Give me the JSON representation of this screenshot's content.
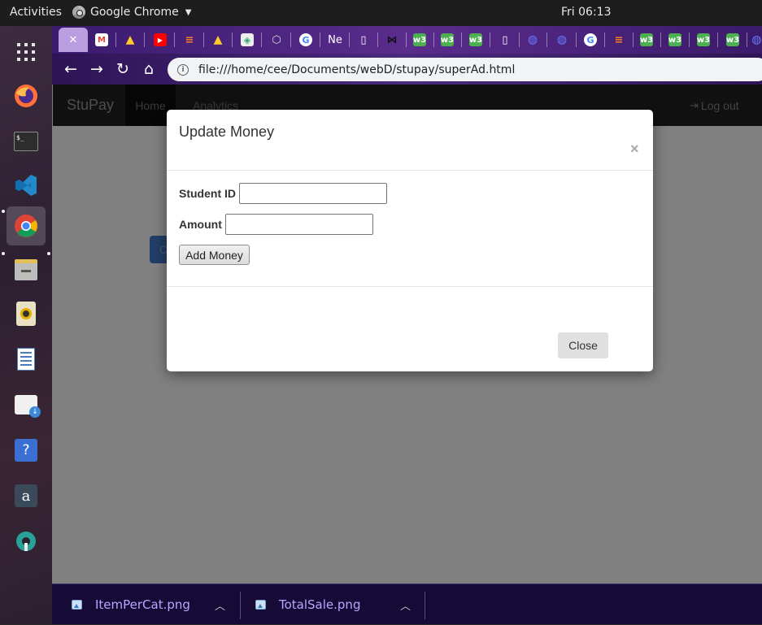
{
  "topbar": {
    "activities": "Activities",
    "app_name": "Google Chrome",
    "clock": "Fri 06:13"
  },
  "dock": {
    "apps": [
      "app-grid-icon",
      "firefox-icon",
      "terminal-icon",
      "vscode-icon",
      "chrome-icon",
      "files-icon",
      "rhythmbox-icon",
      "writer-icon",
      "software-icon",
      "help-icon",
      "amazon-icon",
      "settings-icon"
    ]
  },
  "browser": {
    "tabs": [
      {
        "icon": "close-icon",
        "label": "✕"
      },
      {
        "icon": "gmail-icon",
        "label": "M"
      },
      {
        "icon": "firebase-icon",
        "label": ""
      },
      {
        "icon": "youtube-icon",
        "label": "▶"
      },
      {
        "icon": "stackoverflow-icon",
        "label": ""
      },
      {
        "icon": "firebase-icon",
        "label": ""
      },
      {
        "icon": "diamond-icon",
        "label": ""
      },
      {
        "icon": "codepen-icon",
        "label": ""
      },
      {
        "icon": "google-icon",
        "label": "G"
      },
      {
        "icon": "new-tab-text",
        "label": "Ne"
      },
      {
        "icon": "document-icon",
        "label": ""
      },
      {
        "icon": "bowtie-icon",
        "label": "⋈"
      },
      {
        "icon": "w3schools-icon",
        "label": "w3"
      },
      {
        "icon": "w3schools-icon",
        "label": "w3"
      },
      {
        "icon": "w3schools-icon",
        "label": "w3"
      },
      {
        "icon": "document-icon",
        "label": ""
      },
      {
        "icon": "globe-icon",
        "label": ""
      },
      {
        "icon": "globe-icon",
        "label": ""
      },
      {
        "icon": "google-icon",
        "label": "G"
      },
      {
        "icon": "stackoverflow-icon",
        "label": ""
      },
      {
        "icon": "w3schools-icon",
        "label": "w3"
      },
      {
        "icon": "w3schools-icon",
        "label": "w3"
      },
      {
        "icon": "w3schools-icon",
        "label": "w3"
      },
      {
        "icon": "w3schools-icon",
        "label": "w3"
      },
      {
        "icon": "globe-icon",
        "label": ""
      }
    ],
    "url": "file:///home/cee/Documents/webD/stupay/superAd.html"
  },
  "page": {
    "brand": "StuPay",
    "nav_home": "Home",
    "nav_analytics": "Analytics",
    "logout": "Log out",
    "bg_button": "C"
  },
  "modal": {
    "title": "Update Money",
    "close_x": "×",
    "student_id_label": "Student ID",
    "student_id_value": "",
    "amount_label": "Amount",
    "amount_value": "",
    "add_button": "Add Money",
    "close_button": "Close"
  },
  "downloads": [
    {
      "name": "ItemPerCat.png"
    },
    {
      "name": "TotalSale.png"
    }
  ],
  "colors": {
    "gmail": "#ea4335",
    "youtube": "#ff0000",
    "firebase": "#ffca28",
    "w3schools": "#4caf50",
    "chrome_active_tab": "#b99ee0",
    "modal_overlay": "#808080"
  }
}
